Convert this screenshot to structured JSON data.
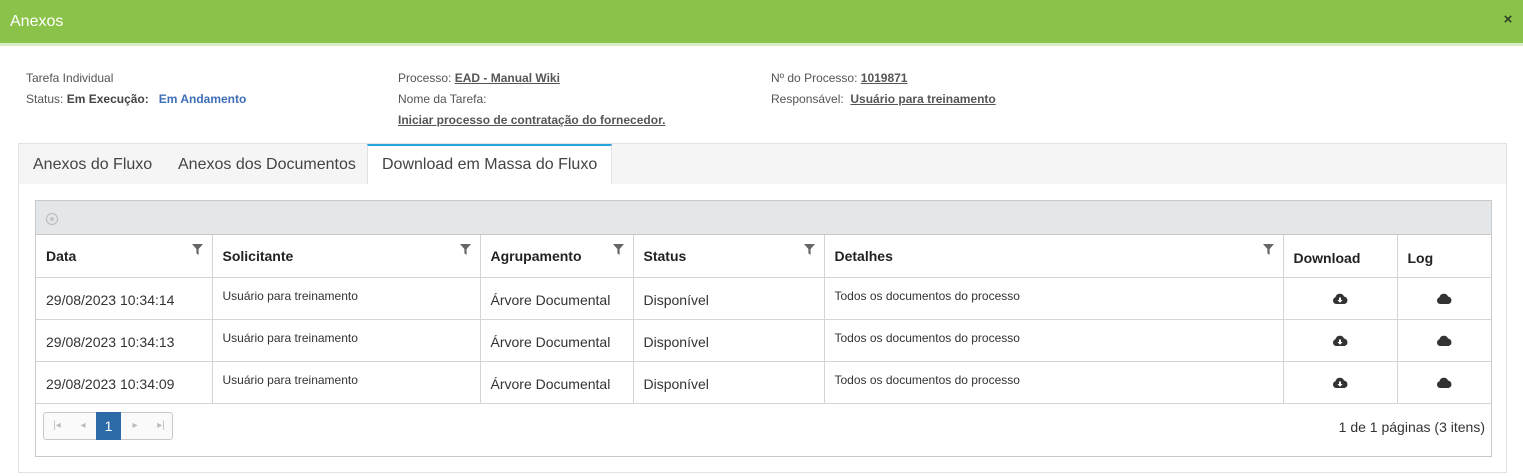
{
  "window": {
    "title": "Anexos",
    "close_glyph": "×"
  },
  "info": {
    "tarefa_individual": "Tarefa Individual",
    "status_label": "Status:",
    "status_value": "Em Execução:",
    "status_link": "Em Andamento",
    "processo_label": "Processo:",
    "processo_link": "EAD - Manual Wiki",
    "nome_tarefa_label": "Nome da Tarefa:",
    "nome_tarefa_link": "Iniciar processo de contratação do fornecedor.",
    "numero_label": "Nº do Processo:",
    "numero_link": "1019871",
    "responsavel_label": "Responsável:",
    "responsavel_link": "Usuário para treinamento"
  },
  "tabs": [
    {
      "label": "Anexos do Fluxo"
    },
    {
      "label": "Anexos dos Documentos"
    },
    {
      "label": "Download em Massa do Fluxo"
    }
  ],
  "table": {
    "headers": [
      "Data",
      "Solicitante",
      "Agrupamento",
      "Status",
      "Detalhes",
      "Download",
      "Log"
    ],
    "rows": [
      {
        "data": "29/08/2023 10:34:14",
        "solicitante": "Usuário para treinamento",
        "agrupamento": "Árvore Documental",
        "status": "Disponível",
        "detalhes": "Todos os documentos do processo"
      },
      {
        "data": "29/08/2023 10:34:13",
        "solicitante": "Usuário para treinamento",
        "agrupamento": "Árvore Documental",
        "status": "Disponível",
        "detalhes": "Todos os documentos do processo"
      },
      {
        "data": "29/08/2023 10:34:09",
        "solicitante": "Usuário para treinamento",
        "agrupamento": "Árvore Documental",
        "status": "Disponível",
        "detalhes": "Todos os documentos do processo"
      }
    ]
  },
  "pager": {
    "current_page": "1",
    "info": "1 de 1 páginas (3 itens)"
  },
  "colors": {
    "header_green": "#8bc34a",
    "tab_accent": "#2aa3dc",
    "link_blue": "#3d6fb6",
    "pager_blue": "#2c6aa8"
  },
  "icons": [
    "close-icon",
    "clear-filter-icon",
    "filter-icon",
    "cloud-download-icon",
    "cloud-icon",
    "first-page-icon",
    "prev-page-icon",
    "next-page-icon",
    "last-page-icon"
  ]
}
